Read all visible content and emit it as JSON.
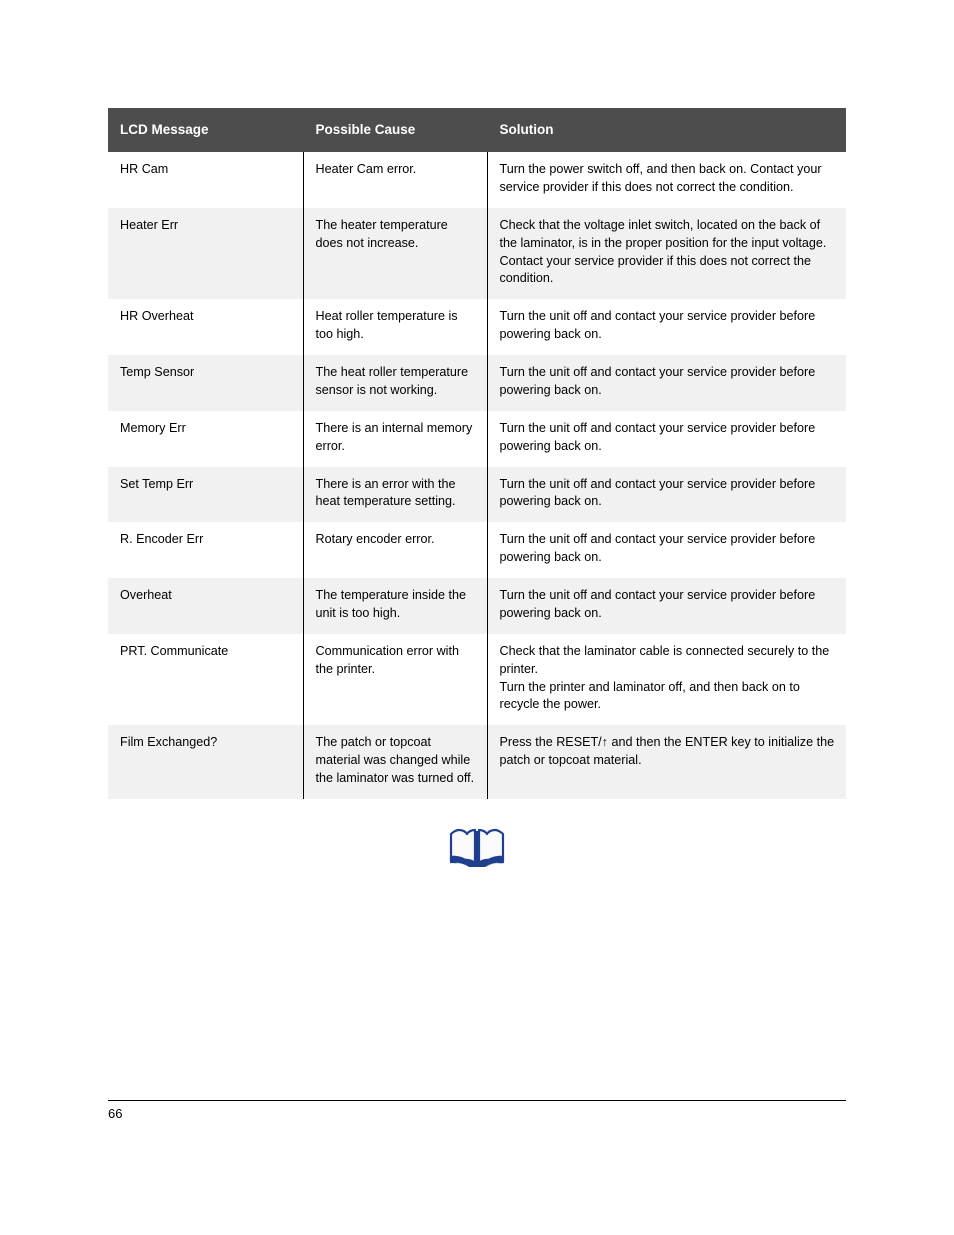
{
  "document": {
    "page_number": "66",
    "icon": "open-book-icon",
    "colors": {
      "header_background": "#4d4d4d",
      "header_text": "#ffffff",
      "row_shade": "#f1f1f1",
      "row_plain": "#ffffff",
      "rule": "#000000",
      "book_icon_outline": "#1f3f8f",
      "book_icon_page": "#fafafa"
    }
  },
  "table": {
    "columns": [
      {
        "key": "lcd_message",
        "label": "LCD Message"
      },
      {
        "key": "possible_cause",
        "label": "Possible Cause"
      },
      {
        "key": "solution",
        "label": "Solution"
      }
    ],
    "rows": [
      {
        "lcd_message": "HR Cam",
        "possible_cause": "Heater Cam error.",
        "solution": "Turn the power switch off, and then back on. Contact your service provider if this does not correct the condition.",
        "shaded": false
      },
      {
        "lcd_message": "Heater Err",
        "possible_cause": "The heater temperature does not increase.",
        "solution": "Check that the voltage inlet switch, located on the back of the laminator, is in the proper position for the input voltage. Contact your service provider if this does not correct the condition.",
        "shaded": true
      },
      {
        "lcd_message": "HR Overheat",
        "possible_cause": "Heat roller temperature is too high.",
        "solution": "Turn the unit off and contact your service provider before powering back on.",
        "shaded": false
      },
      {
        "lcd_message": "Temp Sensor",
        "possible_cause": "The heat roller temperature sensor is not working.",
        "solution": "Turn the unit off and contact your service provider before powering back on.",
        "shaded": true
      },
      {
        "lcd_message": "Memory Err",
        "possible_cause": "There is an internal memory error.",
        "solution": "Turn the unit off and contact your service provider before powering back on.",
        "shaded": false
      },
      {
        "lcd_message": "Set Temp Err",
        "possible_cause": "There is an error with the heat temperature setting.",
        "solution": "Turn the unit off and contact your service provider before powering back on.",
        "shaded": true
      },
      {
        "lcd_message": "R. Encoder Err",
        "possible_cause": "Rotary encoder error.",
        "solution": "Turn the unit off and contact your service provider before powering back on.",
        "shaded": false
      },
      {
        "lcd_message": "Overheat",
        "possible_cause": "The temperature inside the unit is too high.",
        "solution": "Turn the unit off and contact your service provider before powering back on.",
        "shaded": true
      },
      {
        "lcd_message": "PRT. Communicate",
        "possible_cause": "Communication error with the printer.",
        "solution": "Check that the laminator cable is connected securely to the printer.\nTurn the printer and laminator off, and then back on to recycle the power.",
        "shaded": false
      },
      {
        "lcd_message": "Film Exchanged?",
        "possible_cause": "The patch or topcoat material was changed while the laminator was turned off.",
        "solution": "Press the RESET/↑ and then the ENTER key to initialize the patch or topcoat material.",
        "shaded": true
      }
    ]
  }
}
